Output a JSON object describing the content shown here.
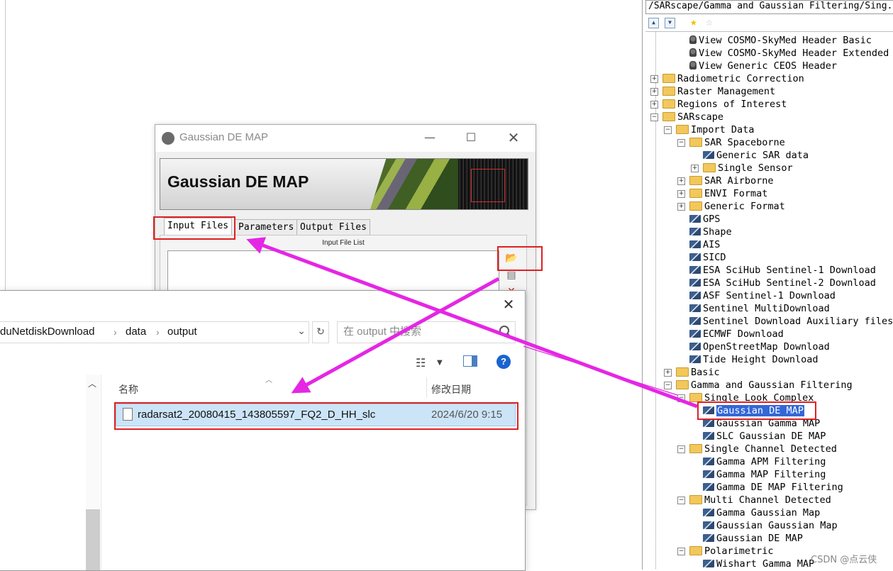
{
  "toolbox": {
    "path": "/SARscape/Gamma and Gaussian Filtering/Sing.",
    "tree": [
      {
        "label": "View COSMO-SkyMed Header Basic",
        "icon": "view",
        "depth": 2
      },
      {
        "label": "View COSMO-SkyMed Header Extended",
        "icon": "view",
        "depth": 2
      },
      {
        "label": "View Generic CEOS Header",
        "icon": "view",
        "depth": 2
      },
      {
        "label": "Radiometric Correction",
        "icon": "folder",
        "depth": 0,
        "expander": "+"
      },
      {
        "label": "Raster Management",
        "icon": "folder",
        "depth": 0,
        "expander": "+"
      },
      {
        "label": "Regions of Interest",
        "icon": "folder",
        "depth": 0,
        "expander": "+"
      },
      {
        "label": "SARscape",
        "icon": "folder",
        "depth": 0,
        "expander": "-"
      },
      {
        "label": "Import Data",
        "icon": "folder",
        "depth": 1,
        "expander": "-"
      },
      {
        "label": "SAR Spaceborne",
        "icon": "folder",
        "depth": 2,
        "expander": "-"
      },
      {
        "label": "Generic SAR data",
        "icon": "tool",
        "depth": 3
      },
      {
        "label": "Single Sensor",
        "icon": "folder",
        "depth": 3,
        "expander": "+"
      },
      {
        "label": "SAR Airborne",
        "icon": "folder",
        "depth": 2,
        "expander": "+"
      },
      {
        "label": "ENVI Format",
        "icon": "folder",
        "depth": 2,
        "expander": "+"
      },
      {
        "label": "Generic Format",
        "icon": "folder",
        "depth": 2,
        "expander": "+"
      },
      {
        "label": "GPS",
        "icon": "tool",
        "depth": 2
      },
      {
        "label": "Shape",
        "icon": "tool",
        "depth": 2
      },
      {
        "label": "AIS",
        "icon": "tool",
        "depth": 2
      },
      {
        "label": "SICD",
        "icon": "tool",
        "depth": 2
      },
      {
        "label": "ESA SciHub Sentinel-1 Download",
        "icon": "tool",
        "depth": 2
      },
      {
        "label": "ESA SciHub Sentinel-2 Download",
        "icon": "tool",
        "depth": 2
      },
      {
        "label": "ASF Sentinel-1 Download",
        "icon": "tool",
        "depth": 2
      },
      {
        "label": "Sentinel MultiDownload",
        "icon": "tool",
        "depth": 2
      },
      {
        "label": "Sentinel Download Auxiliary files",
        "icon": "tool",
        "depth": 2
      },
      {
        "label": "ECMWF Download",
        "icon": "tool",
        "depth": 2
      },
      {
        "label": "OpenStreetMap Download",
        "icon": "tool",
        "depth": 2
      },
      {
        "label": "Tide Height Download",
        "icon": "tool",
        "depth": 2
      },
      {
        "label": "Basic",
        "icon": "folder",
        "depth": 1,
        "expander": "+"
      },
      {
        "label": "Gamma and Gaussian Filtering",
        "icon": "folder",
        "depth": 1,
        "expander": "-"
      },
      {
        "label": "Single Look Complex",
        "icon": "folder",
        "depth": 2,
        "expander": "-"
      },
      {
        "label": "Gaussian DE MAP",
        "icon": "tool",
        "depth": 3,
        "selected": true
      },
      {
        "label": "Gaussian Gamma MAP",
        "icon": "tool",
        "depth": 3
      },
      {
        "label": "SLC Gaussian DE MAP",
        "icon": "tool",
        "depth": 3
      },
      {
        "label": "Single Channel Detected",
        "icon": "folder",
        "depth": 2,
        "expander": "-"
      },
      {
        "label": "Gamma APM Filtering",
        "icon": "tool",
        "depth": 3
      },
      {
        "label": "Gamma MAP Filtering",
        "icon": "tool",
        "depth": 3
      },
      {
        "label": "Gamma DE MAP Filtering",
        "icon": "tool",
        "depth": 3
      },
      {
        "label": "Multi Channel Detected",
        "icon": "folder",
        "depth": 2,
        "expander": "-"
      },
      {
        "label": "Gamma Gaussian Map",
        "icon": "tool",
        "depth": 3
      },
      {
        "label": "Gaussian Gaussian Map",
        "icon": "tool",
        "depth": 3
      },
      {
        "label": "Gaussian DE MAP",
        "icon": "tool",
        "depth": 3
      },
      {
        "label": "Polarimetric",
        "icon": "folder",
        "depth": 2,
        "expander": "-"
      },
      {
        "label": "Wishart Gamma MAP",
        "icon": "tool",
        "depth": 3
      }
    ]
  },
  "dialog": {
    "title": "Gaussian DE MAP",
    "banner_title": "Gaussian DE MAP",
    "tabs": [
      "Input Files",
      "Parameters",
      "Output Files"
    ],
    "active_tab": "Input Files",
    "list_label": "Input File List"
  },
  "explorer": {
    "breadcrumb": [
      "duNetdiskDownload",
      "data",
      "output"
    ],
    "search_placeholder": "在 output 中搜索",
    "columns": {
      "name": "名称",
      "modified": "修改日期"
    },
    "files": [
      {
        "name": "radarsat2_20080415_143805597_FQ2_D_HH_slc",
        "modified": "2024/6/20 9:15"
      }
    ]
  },
  "watermark": "CSDN @点云侠",
  "colors": {
    "annotation_red": "#e02020",
    "arrow_magenta": "#e526e5",
    "selection_blue": "#3367d6"
  }
}
